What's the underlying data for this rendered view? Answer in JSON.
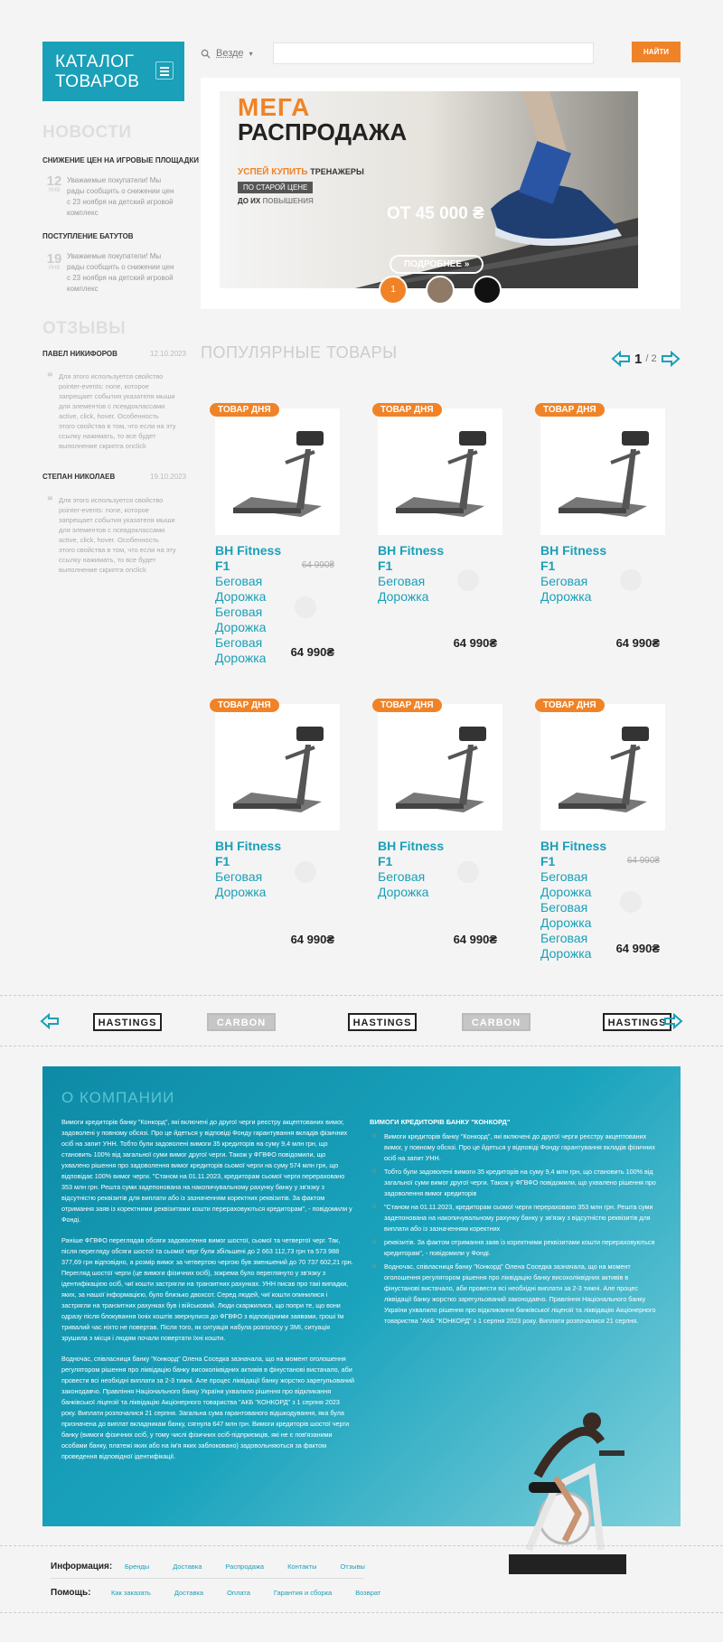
{
  "header": {
    "catalog_label": "КАТАЛОГ ТОВАРОВ",
    "search_scope": "Везде",
    "search_placeholder": "",
    "search_button": "НАЙТИ"
  },
  "news": {
    "title": "НОВОСТИ",
    "items": [
      {
        "title": "СНИЖЕНИЕ ЦЕН НА ИГРОВЫЕ ПЛОЩАДКИ",
        "day": "12",
        "month": "ЯНВ",
        "text": "Уважаемые покупатели! Мы рады сообщить о снижении цен с 23 ноября на детский игровой комплекс"
      },
      {
        "title": "ПОСТУПЛЕНИЕ БАТУТОВ",
        "day": "19",
        "month": "ЯНВ",
        "text": "Уважаемые покупатели! Мы рады сообщить о снижении цен с 23 ноября на детский игровой комплекс"
      }
    ]
  },
  "reviews": {
    "title": "ОТЗЫВЫ",
    "items": [
      {
        "name": "ПАВЕЛ НИКИФОРОВ",
        "date": "12.10.2023",
        "text": "Для этого используется свойство pointer-events: none, которое запрещает события указателя мыши для элементов с псевдоклассами active, click, hover. Особенность этого свойства в том, что если на эту ссылку нажимать, то все будет выполнение скрипта onclick"
      },
      {
        "name": "СТЕПАН НИКОЛАЕВ",
        "date": "19.10.2023",
        "text": "Для этого используется свойство pointer-events: none, которое запрещает события указателя мыши для элементов с псевдоклассами active, click, hover. Особенность этого свойства в том, что если на эту ссылку нажимать, то все будет выполнение скрипта onclick"
      }
    ]
  },
  "banner": {
    "line1": "МЕГА",
    "line2": "РАСПРОДАЖА",
    "slogan_a": "УСПЕЙ КУПИТЬ",
    "slogan_b": "ТРЕНАЖЕРЫ",
    "tag": "ПО СТАРОЙ ЦЕНЕ",
    "until_a": "ДО ИХ",
    "until_b": "ПОВЫШЕНИЯ",
    "price": "ОТ 45 000 ₴",
    "more_button": "ПОДРОБНЕЕ",
    "slides": [
      "1"
    ],
    "colors": {
      "accent": "#f08327",
      "brand": "#1aa0b8"
    }
  },
  "popular": {
    "title": "ПОПУЛЯРНЫЕ ТОВАРЫ",
    "page_current": "1",
    "page_total": "/ 2",
    "badge": "ТОВАР ДНЯ",
    "products": [
      {
        "name": "BH Fitness F1",
        "category": "Беговая Дорожка Беговая Дорожка Беговая Дорожка",
        "old_price": "64 990₴",
        "price": "64 990₴"
      },
      {
        "name": "BH Fitness F1",
        "category": "Беговая Дорожка",
        "old_price": "",
        "price": "64 990₴"
      },
      {
        "name": "BH Fitness F1",
        "category": "Беговая Дорожка",
        "old_price": "",
        "price": "64 990₴"
      },
      {
        "name": "BH Fitness F1",
        "category": "Беговая Дорожка",
        "old_price": "",
        "price": "64 990₴"
      },
      {
        "name": "BH Fitness F1",
        "category": "Беговая Дорожка",
        "old_price": "",
        "price": "64 990₴"
      },
      {
        "name": "BH Fitness F1",
        "category": "Беговая Дорожка Беговая Дорожка Беговая Дорожка",
        "old_price": "64 990₴",
        "price": "64 990₴"
      }
    ]
  },
  "brands": [
    "HASTINGS",
    "CARBON",
    "HASTINGS",
    "CARBON",
    "HASTINGS"
  ],
  "about": {
    "title": "О КОМПАНИИ",
    "left_paragraphs": [
      "Вимоги кредиторів банку \"Конкорд\", які включені до другої черги реєстру акцептованих вимог, задоволені у повному обсязі. Про це йдеться у відповіді Фонду гарантування вкладів фізичних осіб на запит УНН. Тобто були задоволені вимоги 35 кредиторів на суму 9,4 млн грн, що становить 100% від загальної суми вимог другої черги. Також у ФГВФО повідомили, що ухвалено рішення про задоволення вимог кредиторів сьомої черги на суму 574 млн грн, що відповідає 100% вимог черги. \"Станом на 01.11.2023, кредиторам сьомої черги перераховано 353 млн грн. Решта суми задепонована на накопичувальному рахунку банку у зв'язку з відсутністю реквізитів для виплати або із зазначенням коректних реквізитів. За фактом отримання заяв із коректними реквізитами кошти перераховуються кредиторам\", - повідомили у Фонді.",
      "Раніше ФГВФО переглядав обсяги задоволення вимог шостої, сьомої та четвертої черг. Так, після перегляду обсяги шостої та сьомої черг були збільшені до 2 663 112,73 грн та 573 988 377,69 грн відповідно, а розмір вимог за четвертою чергою був зменшений до 70 737 602,21 грн. Перегляд шостої черги (це вимоги фізичних осіб), зокрема було переглянуто у зв'язку з ідентифікацією осіб, чиї кошти застрягли на транзитних рахунках. УНН писав про такі випадки, яких, за нашої інформацією, було близько двохсот. Серед людей, чиї кошти опинилися і застрягли на транзитних рахунках був і військовий. Люди скаржилися, що попри те, що вони одразу після блокування їхніх коштів звернулися до ФГВФО з відповідними заявами, гроші їм тривалий час ніхто не повертав. Після того, як ситуація набула розголосу у ЗМІ, ситуація зрушила з місця і людям почали повертати їхні кошти.",
      "Водночас, співласниця банку \"Конкорд\" Олена Соседка зазначала, що на момент оголошення регулятором рішення про ліквідацію банку високоліквідних активів в фінустанові вистачало, аби провести всі необхідні виплати за 2-3 тижні. Але процес ліквідації банку жорстко зарегульований законодавчо. Правління Національного банку України ухвалило рішення про відкликання банківської ліцензії та ліквідацію Акціонерного товариства \"АКБ \"КОНКОРД\" з 1 серпня 2023 року. Виплати розпочалися 21 серпня. Загальна сума гарантованого відшкодування, яка була призначена до виплат вкладникам банку, сягнула 647 млн грн. Вимоги кредиторів шостої черги банку (вимоги фізичних осіб, у тому числі фізичних осіб-підприємців, які не є пов'язаними особами банку, платежі яких або на ім'я яких заблоковано) задовольняються за фактом проведення відповідної ідентифікації."
    ],
    "right_title": "ВИМОГИ КРЕДИТОРІВ БАНКУ \"КОНКОРД\"",
    "right_items": [
      "Вимоги кредиторів банку \"Конкорд\", які включені до другої черги реєстру акцептованих вимог, у повному обсязі. Про це йдеться у відповіді Фонду гарантування вкладів фізичних осіб на запит УНН.",
      "Тобто були задоволені вимоги 35 кредиторів на суму 9,4 млн грн, що становить 100% від загальної суми вимог другої черги. Також у ФГВФО повідомили, що ухвалено рішення про задоволення вимог кредиторів",
      "\"Станом на 01.11.2023, кредиторам сьомої черги перераховано 353 млн грн. Решта суми задепонована на накопичувальному рахунку банку у зв'язку з відсутністю реквізитів для виплати або із зазначенням коректних",
      "реквізитів. За фактом отримання заяв із коректними реквізитами кошти перераховуються кредиторам\", - повідомили у Фонді.",
      "Водночас, співласниця банку \"Конкорд\" Олена Соседка зазначала, що на момент оголошення регулятором рішення про ліквідацію банку високоліквідних активів в фінустанові вистачало, аби провести всі необхідні виплати за 2-3 тижні. Але процес ліквідації банку жорстко зарегульований законодавчо. Правління Національного банку України ухвалило рішення про відкликання банківської ліцензії та ліквідацію Акціонерного товариства \"АКБ \"КОНКОРД\" з 1 серпня 2023 року. Виплати розпочалися 21 серпня."
    ]
  },
  "footer": {
    "info_label": "Информация:",
    "info_links": [
      "Бренды",
      "Доставка",
      "Распродажа",
      "Контакты",
      "Отзывы"
    ],
    "help_label": "Помощь:",
    "help_links": [
      "Как заказать",
      "Доставка",
      "Оплата",
      "Гарантия и сборка",
      "Возврат"
    ]
  }
}
